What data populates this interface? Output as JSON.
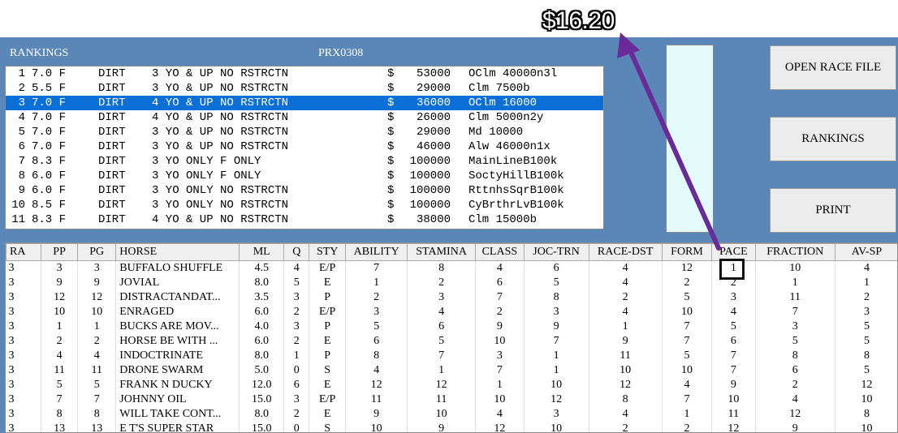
{
  "header": {
    "title": "RANKINGS",
    "file_id": "PRX0308"
  },
  "overlay": {
    "price": "$16.20",
    "arrow_color": "#6a2a9a"
  },
  "colors": {
    "panel": "#5a86b8",
    "selection": "#0a6fd6",
    "swatch": "#e4fbfb"
  },
  "buttons": {
    "open": "OPEN RACE FILE",
    "rankings": "RANKINGS",
    "print": "PRINT"
  },
  "races": [
    {
      "n": "1",
      "dist": "7.0 F",
      "surf": "DIRT",
      "desc": "3 YO & UP NO RSTRCTN",
      "dollar": "$",
      "purse": "53000",
      "type": "OClm 40000n3l"
    },
    {
      "n": "2",
      "dist": "5.5 F",
      "surf": "DIRT",
      "desc": "3 YO & UP NO RSTRCTN",
      "dollar": "$",
      "purse": "29000",
      "type": "Clm 7500b"
    },
    {
      "n": "3",
      "dist": "7.0 F",
      "surf": "DIRT",
      "desc": "4 YO & UP NO RSTRCTN",
      "dollar": "$",
      "purse": "36000",
      "type": "OClm 16000"
    },
    {
      "n": "4",
      "dist": "7.0 F",
      "surf": "DIRT",
      "desc": "4 YO & UP NO RSTRCTN",
      "dollar": "$",
      "purse": "26000",
      "type": "Clm 5000n2y"
    },
    {
      "n": "5",
      "dist": "7.0 F",
      "surf": "DIRT",
      "desc": "3 YO & UP NO RSTRCTN",
      "dollar": "$",
      "purse": "29000",
      "type": "Md 10000"
    },
    {
      "n": "6",
      "dist": "7.0 F",
      "surf": "DIRT",
      "desc": "3 YO & UP NO RSTRCTN",
      "dollar": "$",
      "purse": "46000",
      "type": "Alw 46000n1x"
    },
    {
      "n": "7",
      "dist": "8.3 F",
      "surf": "DIRT",
      "desc": "3 YO ONLY F ONLY",
      "dollar": "$",
      "purse": "100000",
      "type": "MainLineB100k"
    },
    {
      "n": "8",
      "dist": "6.0 F",
      "surf": "DIRT",
      "desc": "3 YO ONLY F ONLY",
      "dollar": "$",
      "purse": "100000",
      "type": "SoctyHillB100k"
    },
    {
      "n": "9",
      "dist": "6.0 F",
      "surf": "DIRT",
      "desc": "3 YO ONLY NO RSTRCTN",
      "dollar": "$",
      "purse": "100000",
      "type": "RttnhsSqrB100k"
    },
    {
      "n": "10",
      "dist": "8.5 F",
      "surf": "DIRT",
      "desc": "3 YO ONLY NO RSTRCTN",
      "dollar": "$",
      "purse": "100000",
      "type": "CyBrthrLvB100k"
    },
    {
      "n": "11",
      "dist": "8.3 F",
      "surf": "DIRT",
      "desc": "4 YO & UP NO RSTRCTN",
      "dollar": "$",
      "purse": "38000",
      "type": "Clm 15000b"
    }
  ],
  "selected_race_index": 2,
  "table": {
    "columns": [
      "RA",
      "PP",
      "PG",
      "HORSE",
      "ML",
      "Q",
      "STY",
      "ABILITY",
      "STAMINA",
      "CLASS",
      "JOC-TRN",
      "RACE-DST",
      "FORM",
      "PACE",
      "FRACTION",
      "AV-SP"
    ],
    "rows": [
      [
        "3",
        "3",
        "3",
        "BUFFALO SHUFFLE",
        "4.5",
        "4",
        "E/P",
        "7",
        "8",
        "4",
        "6",
        "4",
        "12",
        "1",
        "10",
        "4"
      ],
      [
        "3",
        "9",
        "9",
        "JOVIAL",
        "8.0",
        "5",
        "E",
        "1",
        "2",
        "6",
        "5",
        "4",
        "2",
        "2",
        "1",
        "1"
      ],
      [
        "3",
        "12",
        "12",
        "DISTRACTANDAT...",
        "3.5",
        "3",
        "P",
        "2",
        "3",
        "7",
        "8",
        "2",
        "5",
        "3",
        "11",
        "2"
      ],
      [
        "3",
        "10",
        "10",
        "ENRAGED",
        "6.0",
        "2",
        "E/P",
        "3",
        "4",
        "2",
        "3",
        "4",
        "10",
        "4",
        "7",
        "3"
      ],
      [
        "3",
        "1",
        "1",
        "BUCKS ARE MOV...",
        "4.0",
        "3",
        "P",
        "5",
        "6",
        "9",
        "9",
        "1",
        "7",
        "5",
        "3",
        "5"
      ],
      [
        "3",
        "2",
        "2",
        "HORSE BE WITH ...",
        "6.0",
        "2",
        "E",
        "6",
        "5",
        "10",
        "7",
        "9",
        "7",
        "6",
        "5",
        "5"
      ],
      [
        "3",
        "4",
        "4",
        "INDOCTRINATE",
        "8.0",
        "1",
        "P",
        "8",
        "7",
        "3",
        "1",
        "11",
        "5",
        "7",
        "8",
        "8"
      ],
      [
        "3",
        "11",
        "11",
        "DRONE SWARM",
        "5.0",
        "0",
        "S",
        "4",
        "1",
        "7",
        "1",
        "10",
        "10",
        "7",
        "6",
        "5"
      ],
      [
        "3",
        "5",
        "5",
        "FRANK N DUCKY",
        "12.0",
        "6",
        "E",
        "12",
        "12",
        "1",
        "10",
        "12",
        "4",
        "9",
        "2",
        "12"
      ],
      [
        "3",
        "7",
        "7",
        "JOHNNY OIL",
        "15.0",
        "3",
        "E/P",
        "11",
        "11",
        "10",
        "12",
        "8",
        "7",
        "10",
        "4",
        "10"
      ],
      [
        "3",
        "8",
        "8",
        "WILL TAKE CONT...",
        "8.0",
        "2",
        "E",
        "9",
        "10",
        "4",
        "3",
        "4",
        "1",
        "11",
        "12",
        "8"
      ],
      [
        "3",
        "13",
        "13",
        "E T'S SUPER STAR",
        "15.0",
        "0",
        "S",
        "10",
        "9",
        "12",
        "10",
        "2",
        "2",
        "12",
        "9",
        "10"
      ]
    ]
  }
}
